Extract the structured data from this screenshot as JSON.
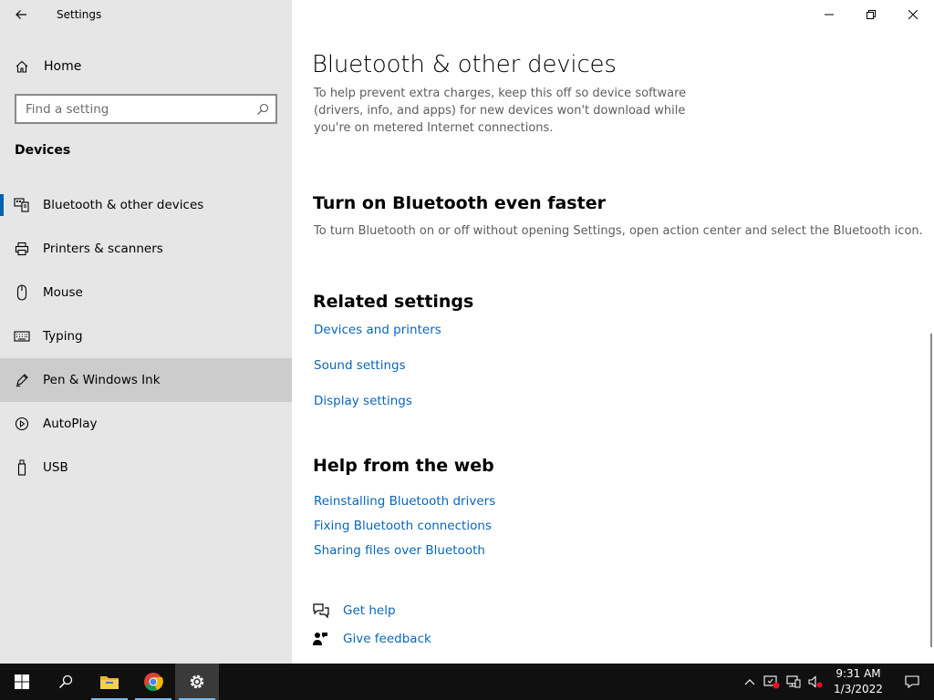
{
  "window": {
    "title": "Settings"
  },
  "sidebar": {
    "home_label": "Home",
    "search_placeholder": "Find a setting",
    "section_title": "Devices",
    "items": [
      {
        "label": "Bluetooth & other devices",
        "icon": "bluetooth-devices-icon",
        "active": true
      },
      {
        "label": "Printers & scanners",
        "icon": "printer-icon"
      },
      {
        "label": "Mouse",
        "icon": "mouse-icon"
      },
      {
        "label": "Typing",
        "icon": "keyboard-icon"
      },
      {
        "label": "Pen & Windows Ink",
        "icon": "pen-icon",
        "hovered": true
      },
      {
        "label": "AutoPlay",
        "icon": "autoplay-icon"
      },
      {
        "label": "USB",
        "icon": "usb-icon"
      }
    ]
  },
  "main": {
    "title": "Bluetooth & other devices",
    "metered_description": "To help prevent extra charges, keep this off so device software (drivers, info, and apps) for new devices won't download while you're on metered Internet connections.",
    "faster": {
      "heading": "Turn on Bluetooth even faster",
      "text": "To turn Bluetooth on or off without opening Settings, open action center and select the Bluetooth icon."
    },
    "related": {
      "heading": "Related settings",
      "links": [
        "Devices and printers",
        "Sound settings",
        "Display settings"
      ]
    },
    "help_web": {
      "heading": "Help from the web",
      "links": [
        "Reinstalling Bluetooth drivers",
        "Fixing Bluetooth connections",
        "Sharing files over Bluetooth"
      ]
    },
    "get_help": "Get help",
    "give_feedback": "Give feedback"
  },
  "taskbar": {
    "apps": [
      "start-icon",
      "search-icon",
      "file-explorer-icon",
      "chrome-icon",
      "settings-icon"
    ],
    "time": "9:31 AM",
    "date": "1/3/2022"
  },
  "colors": {
    "accent": "#0063b1",
    "link": "#0a66b8",
    "sidebar_bg": "#e6e6e6",
    "taskbar_bg": "#101010"
  }
}
